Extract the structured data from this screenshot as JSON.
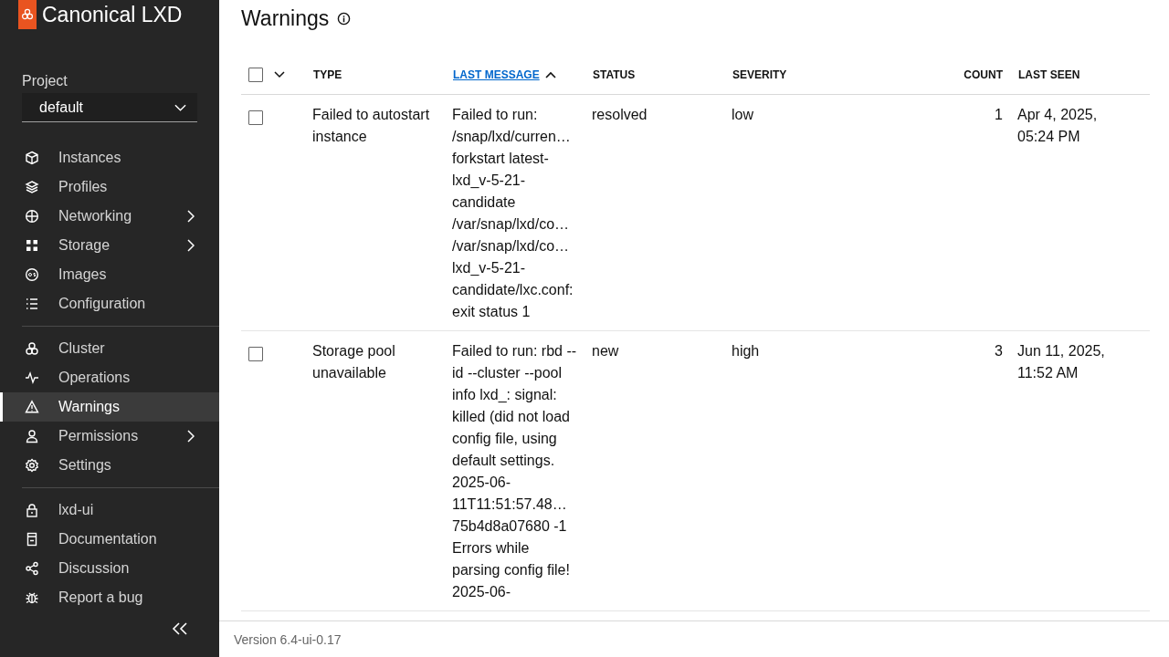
{
  "sidebar": {
    "logo_text": "Canonical LXD",
    "project": {
      "label": "Project",
      "value": "default"
    },
    "nav_groups": [
      [
        {
          "label": "Instances",
          "selected": false,
          "has_submenu": false
        },
        {
          "label": "Profiles",
          "selected": false,
          "has_submenu": false
        },
        {
          "label": "Networking",
          "selected": false,
          "has_submenu": true
        },
        {
          "label": "Storage",
          "selected": false,
          "has_submenu": true
        },
        {
          "label": "Images",
          "selected": false,
          "has_submenu": false
        },
        {
          "label": "Configuration",
          "selected": false,
          "has_submenu": false
        }
      ],
      [
        {
          "label": "Cluster",
          "selected": false,
          "has_submenu": false
        },
        {
          "label": "Operations",
          "selected": false,
          "has_submenu": false
        },
        {
          "label": "Warnings",
          "selected": true,
          "has_submenu": false
        },
        {
          "label": "Permissions",
          "selected": false,
          "has_submenu": true
        },
        {
          "label": "Settings",
          "selected": false,
          "has_submenu": false
        }
      ],
      [
        {
          "label": "lxd-ui",
          "selected": false,
          "has_submenu": false
        },
        {
          "label": "Documentation",
          "selected": false,
          "has_submenu": false
        },
        {
          "label": "Discussion",
          "selected": false,
          "has_submenu": false
        },
        {
          "label": "Report a bug",
          "selected": false,
          "has_submenu": false
        }
      ]
    ]
  },
  "page": {
    "title": "Warnings"
  },
  "table": {
    "select_all_checked": false,
    "columns": [
      {
        "label": "TYPE",
        "sorted": false
      },
      {
        "label": "LAST MESSAGE",
        "sorted": true
      },
      {
        "label": "STATUS",
        "sorted": false
      },
      {
        "label": "SEVERITY",
        "sorted": false
      },
      {
        "label": "COUNT",
        "sorted": false
      },
      {
        "label": "LAST SEEN",
        "sorted": false
      }
    ],
    "rows": [
      {
        "checked": false,
        "cells": [
          "Failed to autostart instance",
          "Failed to run:\n/snap/lxd/curren…\nforkstart latest-\nlxd_v-5-21-\ncandidate\n/var/snap/lxd/co…\n/var/snap/lxd/co…\nlxd_v-5-21-\ncandidate/lxc.conf:\nexit status 1",
          "resolved",
          "low",
          "1",
          "Apr 4, 2025,\n05:24 PM"
        ]
      },
      {
        "checked": false,
        "cells": [
          "Storage pool unavailable",
          "Failed to run: rbd --\nid --cluster --pool\ninfo lxd_: signal:\nkilled (did not load\nconfig file, using\ndefault settings.\n2025-06-\n11T11:51:57.48…\n75b4d8a07680 -1\nErrors while\nparsing config file!\n2025-06-",
          "new",
          "high",
          "3",
          "Jun 11, 2025,\n11:52 AM"
        ]
      }
    ]
  },
  "footer": {
    "version": "Version 6.4-ui-0.17"
  }
}
